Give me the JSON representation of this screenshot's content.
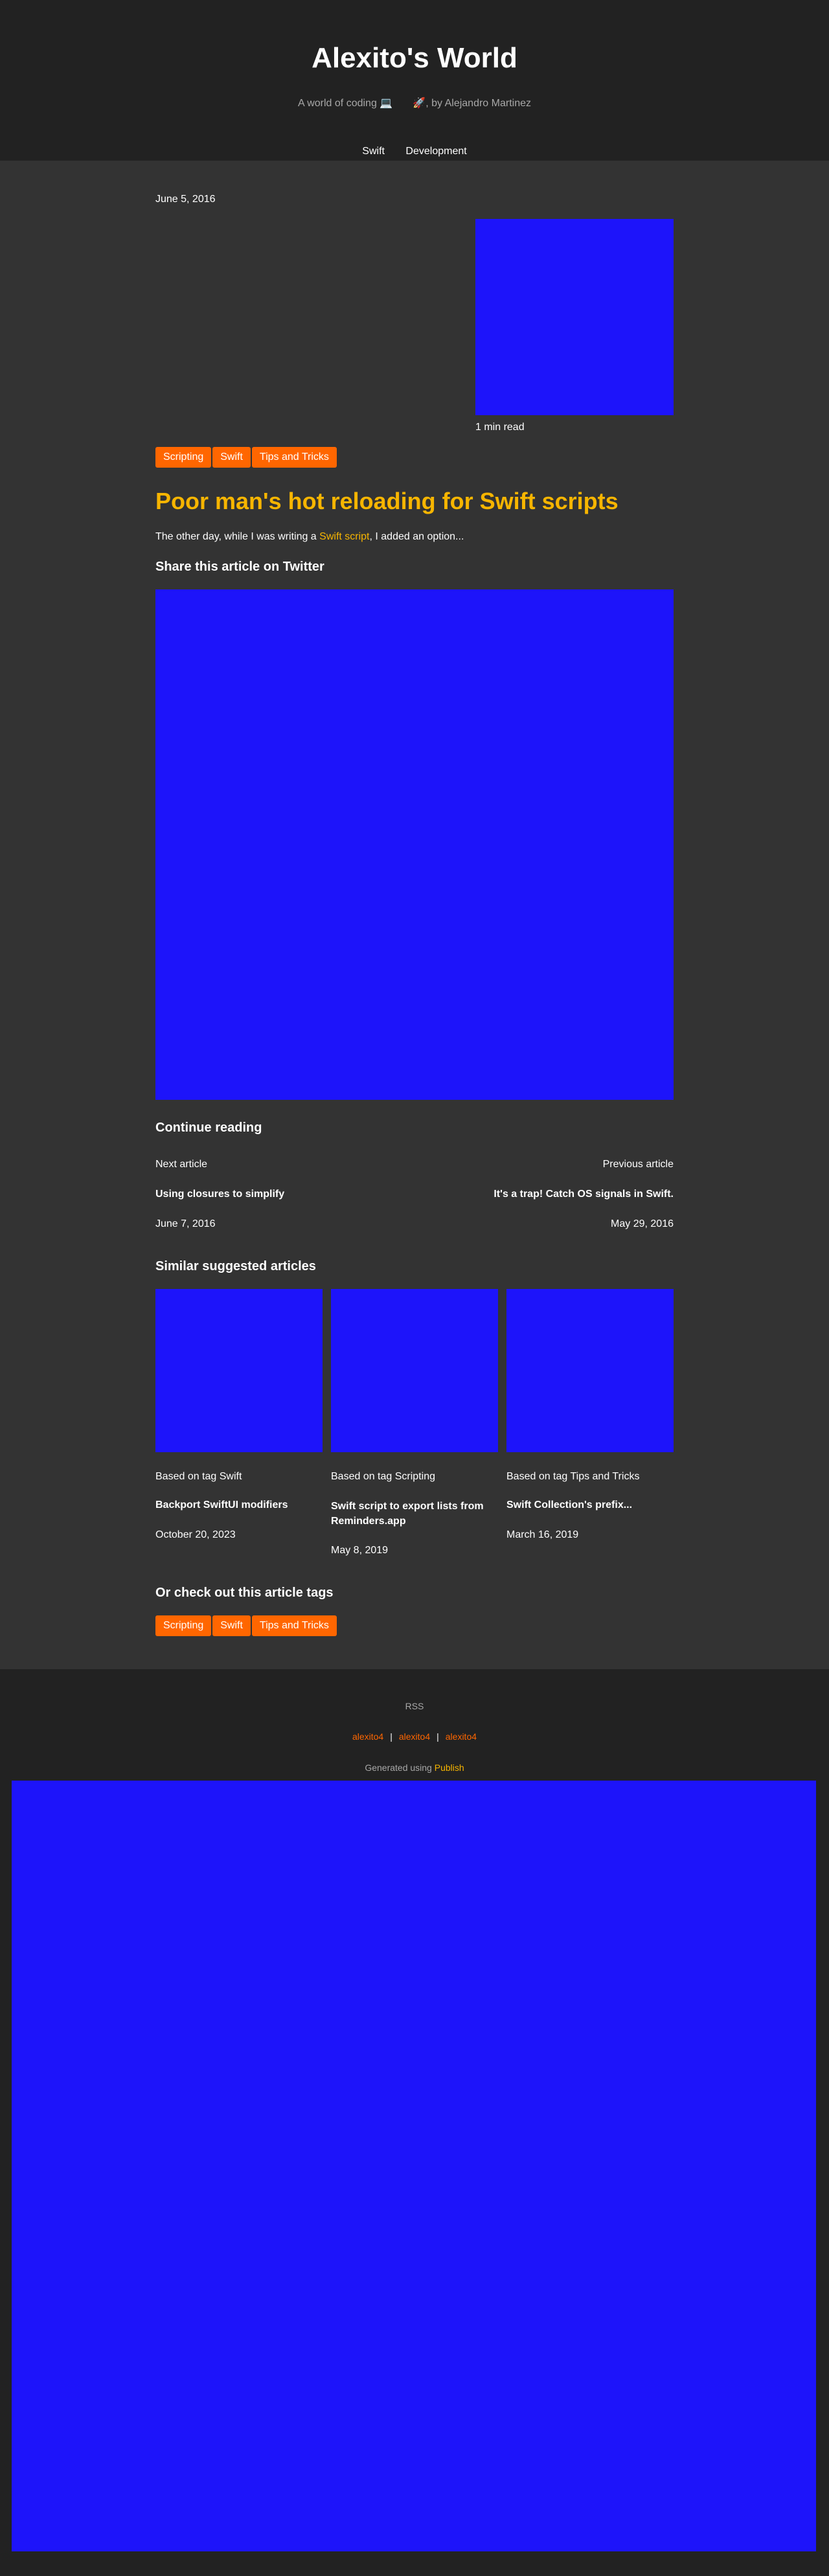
{
  "site": {
    "title": "Alexito's World",
    "tagline_prefix": "A world of coding ",
    "tagline_emoji_1": "💻",
    "tagline_emoji_2": "🚀",
    "tagline_suffix": ", by Alejandro Martinez",
    "nav": [
      "Swift",
      "Development"
    ]
  },
  "post": {
    "date": "June 5, 2016",
    "read_time": "1 min read",
    "tags": [
      "Scripting",
      "Swift",
      "Tips and Tricks"
    ],
    "title": "Poor man's hot reloading for Swift scripts",
    "excerpt_before": "The other day, while I was writing a ",
    "excerpt_link": "Swift script",
    "excerpt_after": ", I added an option...",
    "share_heading": "Share this article on Twitter"
  },
  "continue": {
    "heading": "Continue reading",
    "next_label": "Next article",
    "next_title": "Using closures to simplify",
    "next_date": "June 7, 2016",
    "prev_label": "Previous article",
    "prev_title": "It's a trap! Catch OS signals in Swift.",
    "prev_date": "May 29, 2016"
  },
  "similar": {
    "heading": "Similar suggested articles",
    "items": [
      {
        "based_on": "Based on tag Swift",
        "title": "Backport SwiftUI modifiers",
        "date": "October 20, 2023"
      },
      {
        "based_on": "Based on tag Scripting",
        "title": "Swift script to export lists from Reminders.app",
        "date": "May 8, 2019"
      },
      {
        "based_on": "Based on tag Tips and Tricks",
        "title": "Swift Collection's prefix...",
        "date": "March 16, 2019"
      }
    ]
  },
  "tags_section": {
    "heading": "Or check out this article tags",
    "tags": [
      "Scripting",
      "Swift",
      "Tips and Tricks"
    ]
  },
  "footer": {
    "rss": "RSS",
    "social": [
      "alexito4",
      "alexito4",
      "alexito4"
    ],
    "separator": "|",
    "generated_prefix": "Generated using ",
    "generated_link": "Publish"
  },
  "colors": {
    "background": "#333333",
    "header_bg": "#222222",
    "accent_yellow": "#f7b500",
    "tag_orange": "#ff6600",
    "placeholder_blue": "#1d14fa"
  }
}
